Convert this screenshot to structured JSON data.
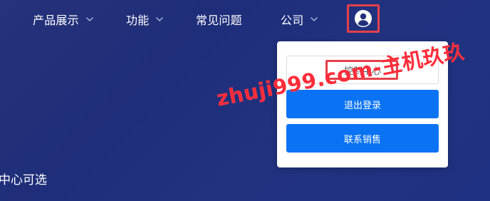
{
  "nav": {
    "items": [
      {
        "label": "产品展示",
        "has_dropdown": true
      },
      {
        "label": "功能",
        "has_dropdown": true
      },
      {
        "label": "常见问题",
        "has_dropdown": false
      },
      {
        "label": "公司",
        "has_dropdown": true
      }
    ],
    "account_icon": "user-circle-icon"
  },
  "dropdown": {
    "control_center_label": "控制中心",
    "logout_label": "退出登录",
    "contact_sales_label": "联系销售"
  },
  "watermark": {
    "text": "zhuji999.com-主机玖玖",
    "color": "#ff2d3a"
  },
  "page": {
    "partial_text": "中心可选"
  },
  "colors": {
    "background": "#22307c",
    "primary_button": "#0a73f4",
    "annotation_red": "#e5404a"
  }
}
